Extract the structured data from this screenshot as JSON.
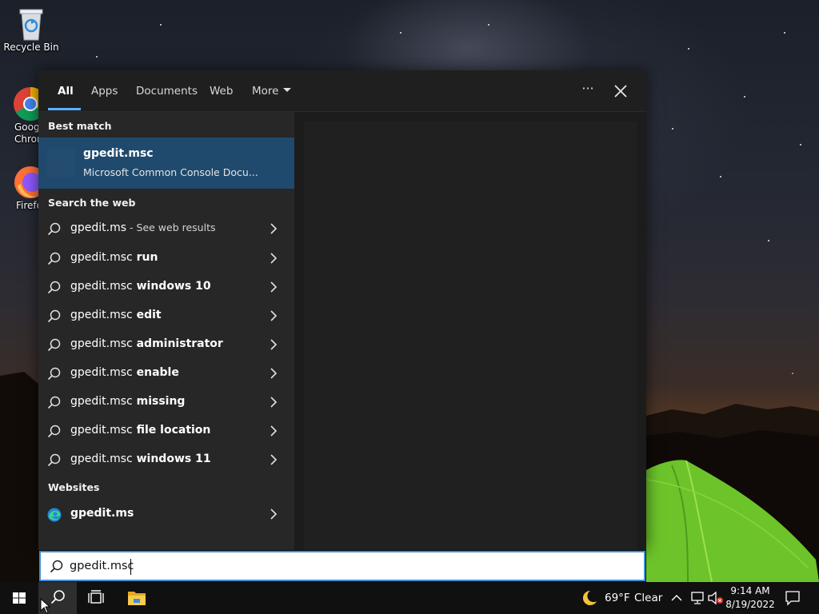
{
  "desktop": {
    "icons": [
      {
        "label": "Recycle Bin"
      },
      {
        "label": "Goog\nChron"
      },
      {
        "label": "Firefo"
      }
    ]
  },
  "search_panel": {
    "tabs": [
      {
        "label": "All",
        "active": true
      },
      {
        "label": "Apps"
      },
      {
        "label": "Documents"
      },
      {
        "label": "Web"
      },
      {
        "label": "More"
      }
    ],
    "ellipsis": "···",
    "best_match": {
      "header": "Best match",
      "title": "gpedit.msc",
      "subtitle": "Microsoft Common Console Docu..."
    },
    "search_the_web": {
      "header": "Search the web",
      "items": [
        {
          "prefix": "gpedit.ms",
          "bold": "",
          "suffix": " - See web results"
        },
        {
          "prefix": "gpedit.msc",
          "bold": " run",
          "suffix": ""
        },
        {
          "prefix": "gpedit.msc",
          "bold": " windows 10",
          "suffix": ""
        },
        {
          "prefix": "gpedit.msc",
          "bold": " edit",
          "suffix": ""
        },
        {
          "prefix": "gpedit.msc",
          "bold": " administrator",
          "suffix": ""
        },
        {
          "prefix": "gpedit.msc",
          "bold": " enable",
          "suffix": ""
        },
        {
          "prefix": "gpedit.msc",
          "bold": " missing",
          "suffix": ""
        },
        {
          "prefix": "gpedit.msc",
          "bold": " file location",
          "suffix": ""
        },
        {
          "prefix": "gpedit.msc",
          "bold": " windows 11",
          "suffix": ""
        }
      ]
    },
    "websites": {
      "header": "Websites",
      "items": [
        {
          "label": "gpedit.ms"
        }
      ]
    }
  },
  "search_box": {
    "value": "gpedit.msc"
  },
  "taskbar": {
    "weather": {
      "temp": "69°F",
      "condition": "Clear"
    },
    "clock": {
      "time": "9:14 AM",
      "date": "8/19/2022"
    }
  },
  "colors": {
    "accent": "#3e8fd8",
    "selected_row": "#1f4a6d",
    "tab_underline": "#5db0ff"
  }
}
